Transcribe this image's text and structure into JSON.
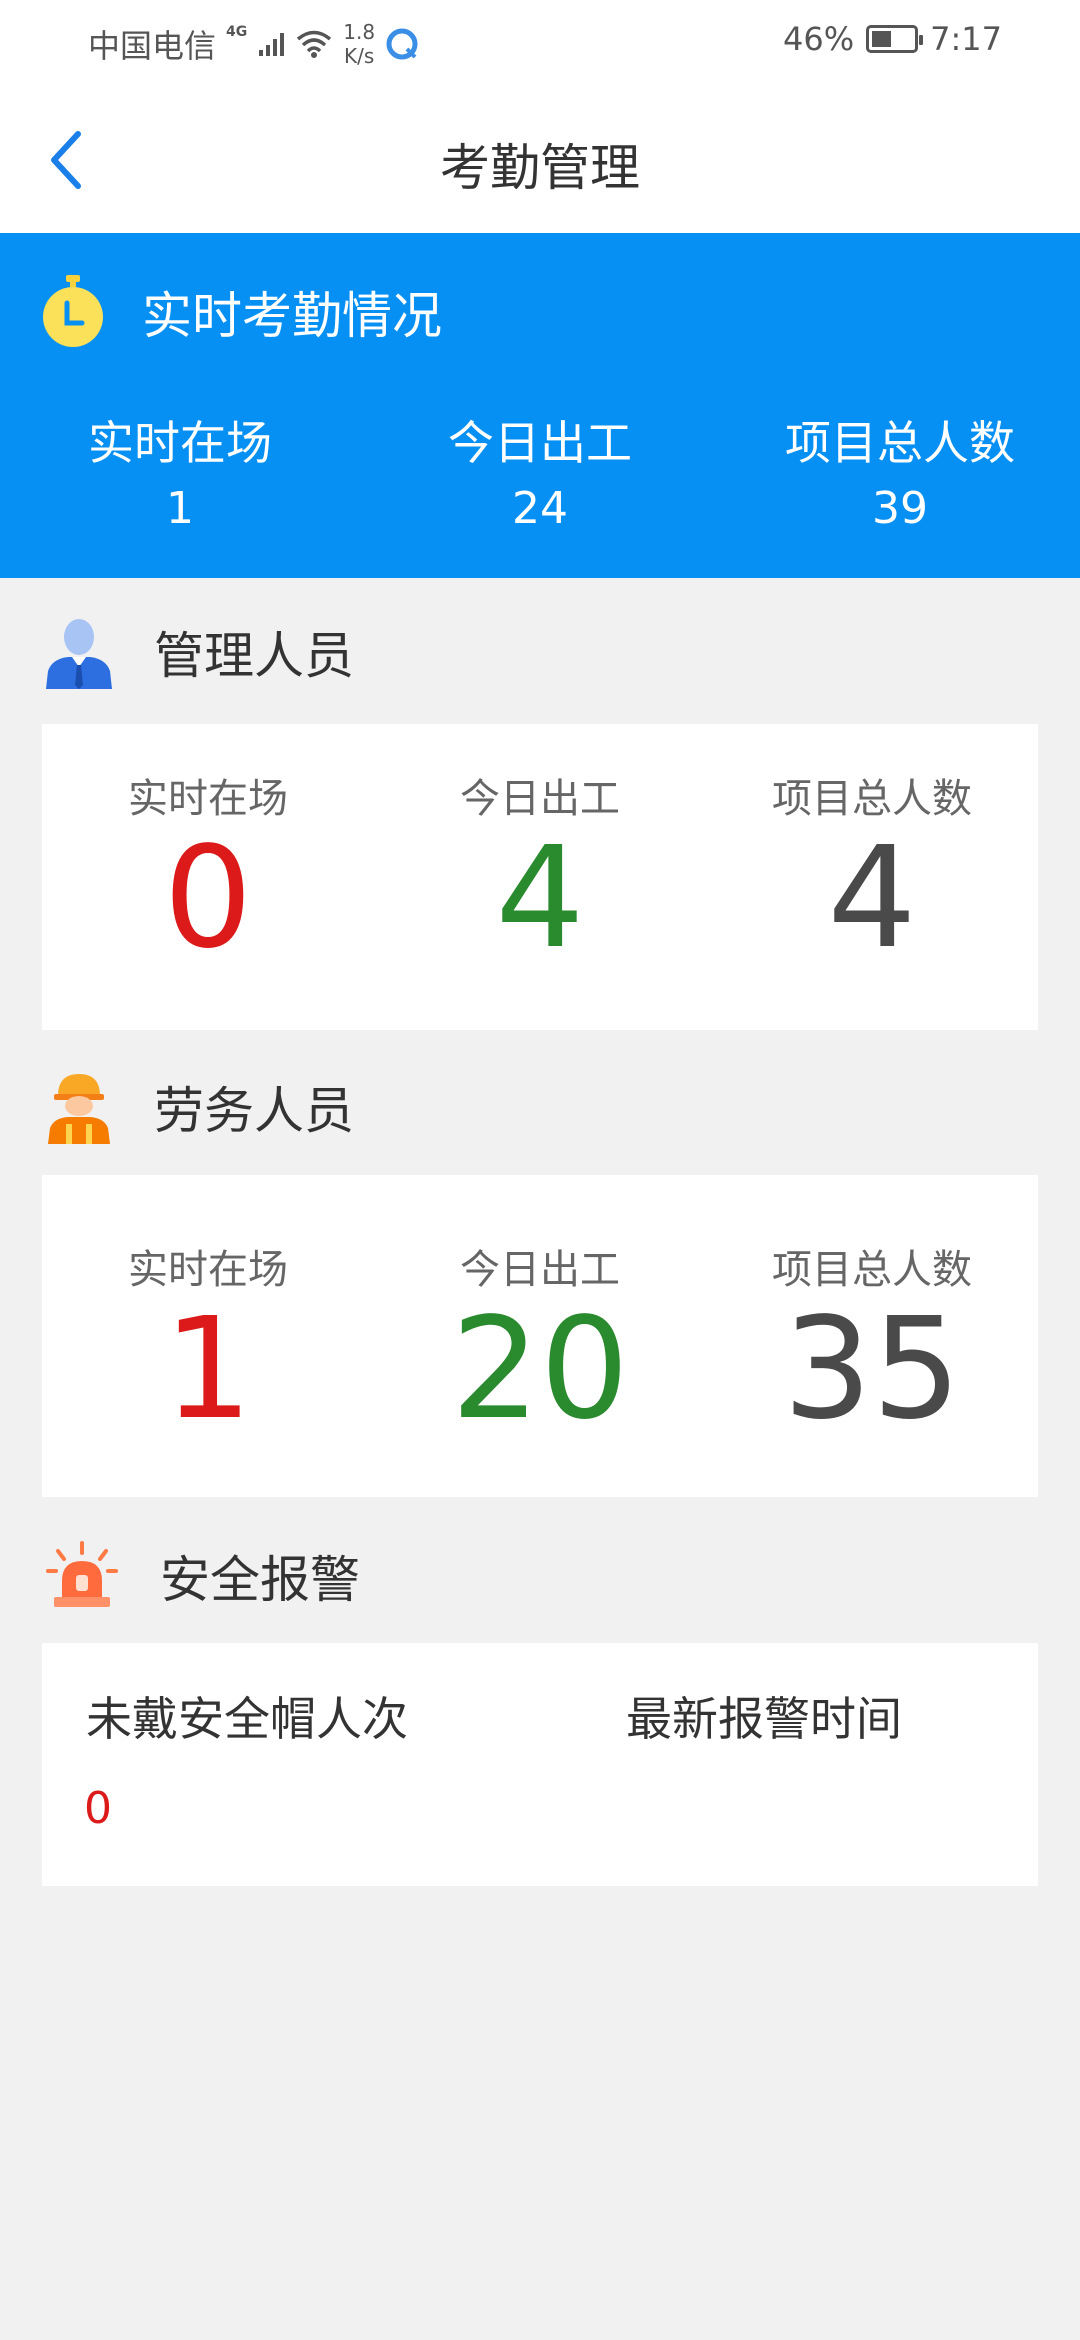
{
  "status_bar": {
    "carrier": "中国电信",
    "network": "4G",
    "speed_value": "1.8",
    "speed_unit": "K/s",
    "battery": "46%",
    "time": "7:17"
  },
  "header": {
    "title": "考勤管理"
  },
  "realtime": {
    "title": "实时考勤情况",
    "stats": [
      {
        "label": "实时在场",
        "value": "1"
      },
      {
        "label": "今日出工",
        "value": "24"
      },
      {
        "label": "项目总人数",
        "value": "39"
      }
    ]
  },
  "management": {
    "title": "管理人员",
    "stats": [
      {
        "label": "实时在场",
        "value": "0"
      },
      {
        "label": "今日出工",
        "value": "4"
      },
      {
        "label": "项目总人数",
        "value": "4"
      }
    ]
  },
  "labor": {
    "title": "劳务人员",
    "stats": [
      {
        "label": "实时在场",
        "value": "1"
      },
      {
        "label": "今日出工",
        "value": "20"
      },
      {
        "label": "项目总人数",
        "value": "35"
      }
    ]
  },
  "safety": {
    "title": "安全报警",
    "no_helmet_label": "未戴安全帽人次",
    "no_helmet_value": "0",
    "latest_alarm_label": "最新报警时间"
  },
  "colors": {
    "primary": "#0790f4",
    "red": "#dd1a1a",
    "green": "#2a8a2e",
    "gray": "#4a4a4a"
  }
}
